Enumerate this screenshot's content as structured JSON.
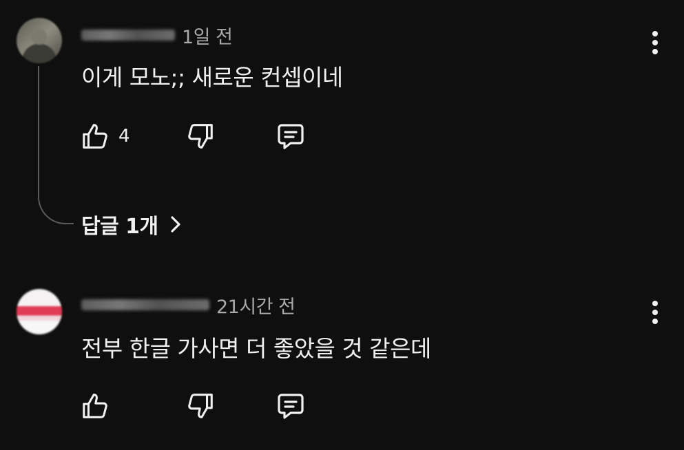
{
  "comments": [
    {
      "timestamp": "1일 전",
      "text": "이게 모노;; 새로운 컨셉이네",
      "like_count": "4",
      "replies_label": "답글 1개"
    },
    {
      "timestamp": "21시간 전",
      "text": "전부 한글 가사면 더 좋았을 것 같은데",
      "like_count": ""
    }
  ],
  "icons": {
    "like": "thumbs-up-icon",
    "dislike": "thumbs-down-icon",
    "reply": "comment-icon",
    "more": "more-vertical-icon",
    "replies_chevron": "chevron-right-icon"
  },
  "colors": {
    "background": "#0f0f0f",
    "text": "#f1f1f1",
    "secondary_text": "#aaaaaa",
    "thread_line": "#5a5a5a"
  }
}
